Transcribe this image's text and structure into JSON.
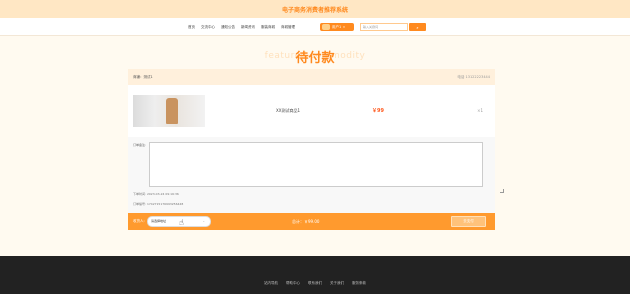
{
  "site": {
    "title": "电子商务消费者推荐系统"
  },
  "nav": {
    "items": [
      "首页",
      "交流中心",
      "通知公告",
      "新闻资讯",
      "服装商城",
      "商城管理"
    ],
    "user_label": "用户1",
    "search_placeholder": "输入关键词",
    "search_icon": "search-icon"
  },
  "page": {
    "title": "待付款",
    "title_bg": "featured commodity"
  },
  "order": {
    "shop_label": "商铺：测试1",
    "shop_phone": "电话 13122223444",
    "item": {
      "name": "XX测试商品1",
      "price": "￥99",
      "qty": "×1"
    },
    "remark_label": "订单备注:",
    "created_label": "下单时间: 2023-03-24 09:16:36",
    "order_no_label": "订单编号: 1742715176993256448",
    "address_label": "收货人:",
    "address_value": "请选择地址",
    "total": "总计：￥99.00",
    "pay_label": "去支付"
  },
  "footer": {
    "links": [
      "站内导航",
      "帮助中心",
      "联系我们",
      "关于我们",
      "服务条款"
    ]
  },
  "colors": {
    "accent": "#ff8a1f",
    "top_bg": "#ffe7c4",
    "footer_bg": "#222222"
  }
}
